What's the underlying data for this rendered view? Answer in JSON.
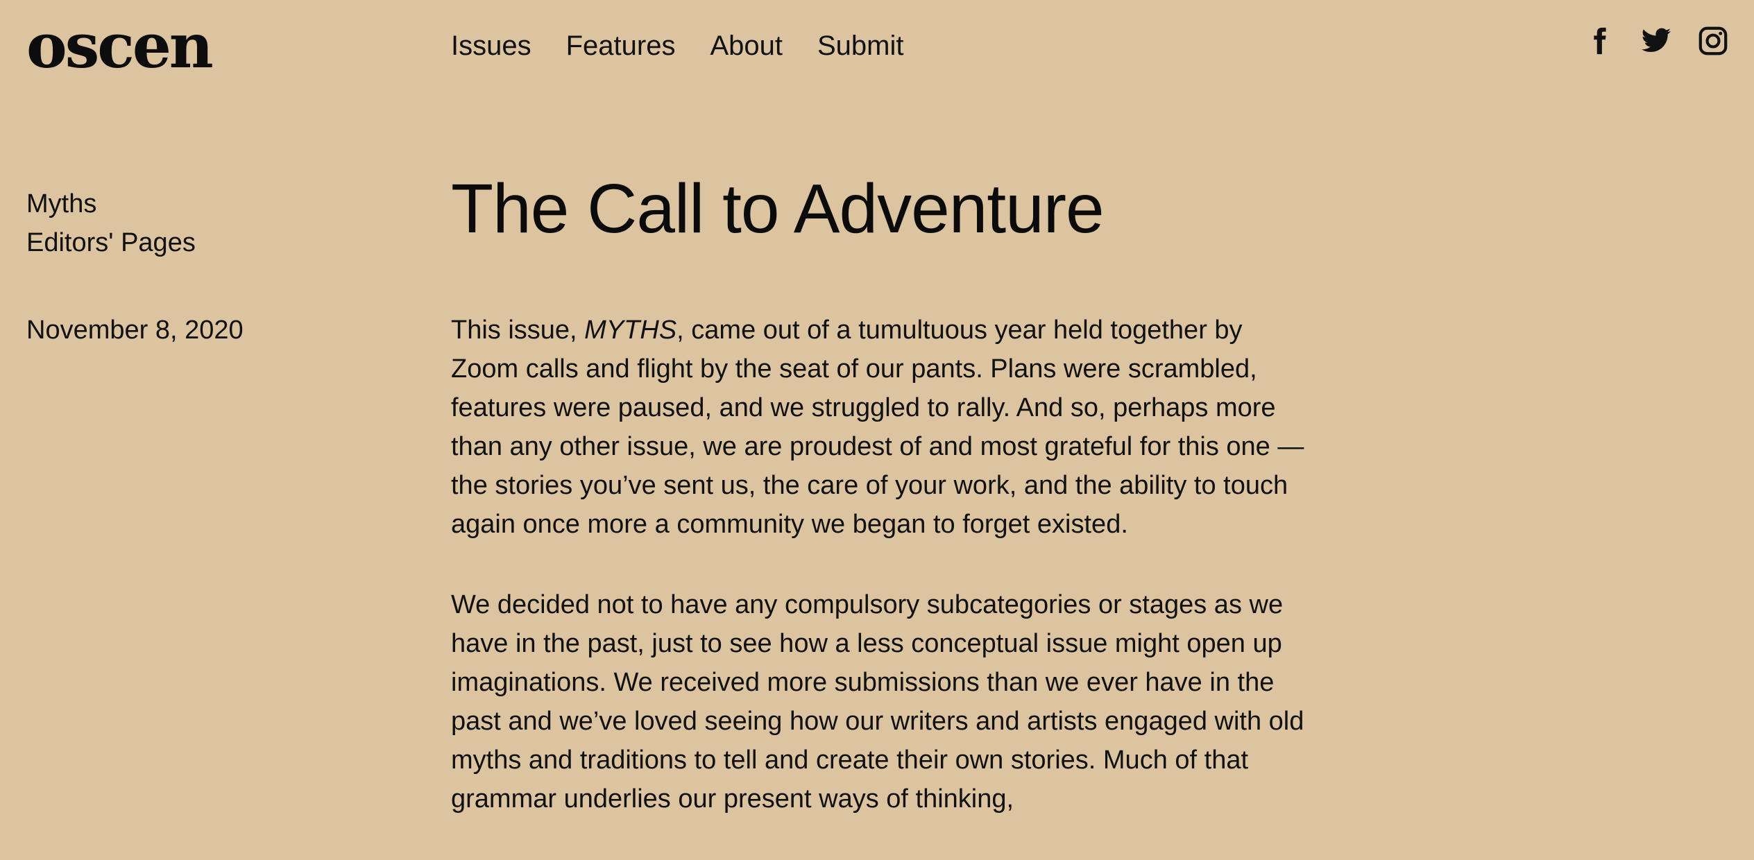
{
  "site": {
    "logo": "oscen"
  },
  "nav": {
    "items": [
      "Issues",
      "Features",
      "About",
      "Submit"
    ]
  },
  "social": {
    "icons": [
      "facebook-icon",
      "twitter-icon",
      "instagram-icon"
    ]
  },
  "sidebar": {
    "categories": [
      "Myths",
      "Editors' Pages"
    ],
    "date": "November 8, 2020"
  },
  "article": {
    "title": "The Call to Adventure",
    "p1_before": "This issue, ",
    "p1_em": "MYTHS",
    "p1_after": ", came out of a tumultuous year held together by Zoom calls and flight by the seat of our pants. Plans were scrambled, features were paused, and we struggled to rally. And so, perhaps more than any other issue, we are proudest of and most grateful for this one — the stories you’ve sent us, the care of your work, and the ability to touch again once more a community we began to forget existed.",
    "p2": "We decided not to have any compulsory subcategories or stages as we have in the past, just to see how a less conceptual issue might open up imaginations. We received more submissions than we ever have in the past and we’ve loved seeing how our writers and artists engaged with old myths and traditions to tell and create their own stories. Much of that grammar underlies our present ways of thinking,"
  },
  "colors": {
    "background": "#dcc4a1",
    "text": "#111111"
  }
}
